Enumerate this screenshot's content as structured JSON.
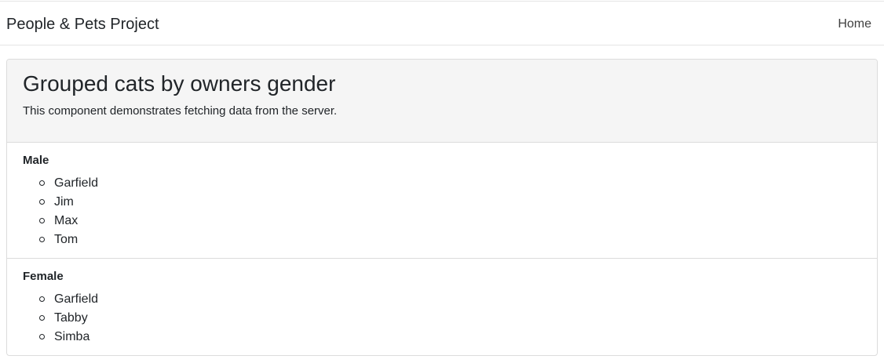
{
  "navbar": {
    "brand": "People & Pets Project",
    "home_link": "Home"
  },
  "header": {
    "title": "Grouped cats by owners gender",
    "subtitle": "This component demonstrates fetching data from the server."
  },
  "groups": [
    {
      "heading": "Male",
      "cats": [
        "Garfield",
        "Jim",
        "Max",
        "Tom"
      ]
    },
    {
      "heading": "Female",
      "cats": [
        "Garfield",
        "Tabby",
        "Simba"
      ]
    }
  ]
}
